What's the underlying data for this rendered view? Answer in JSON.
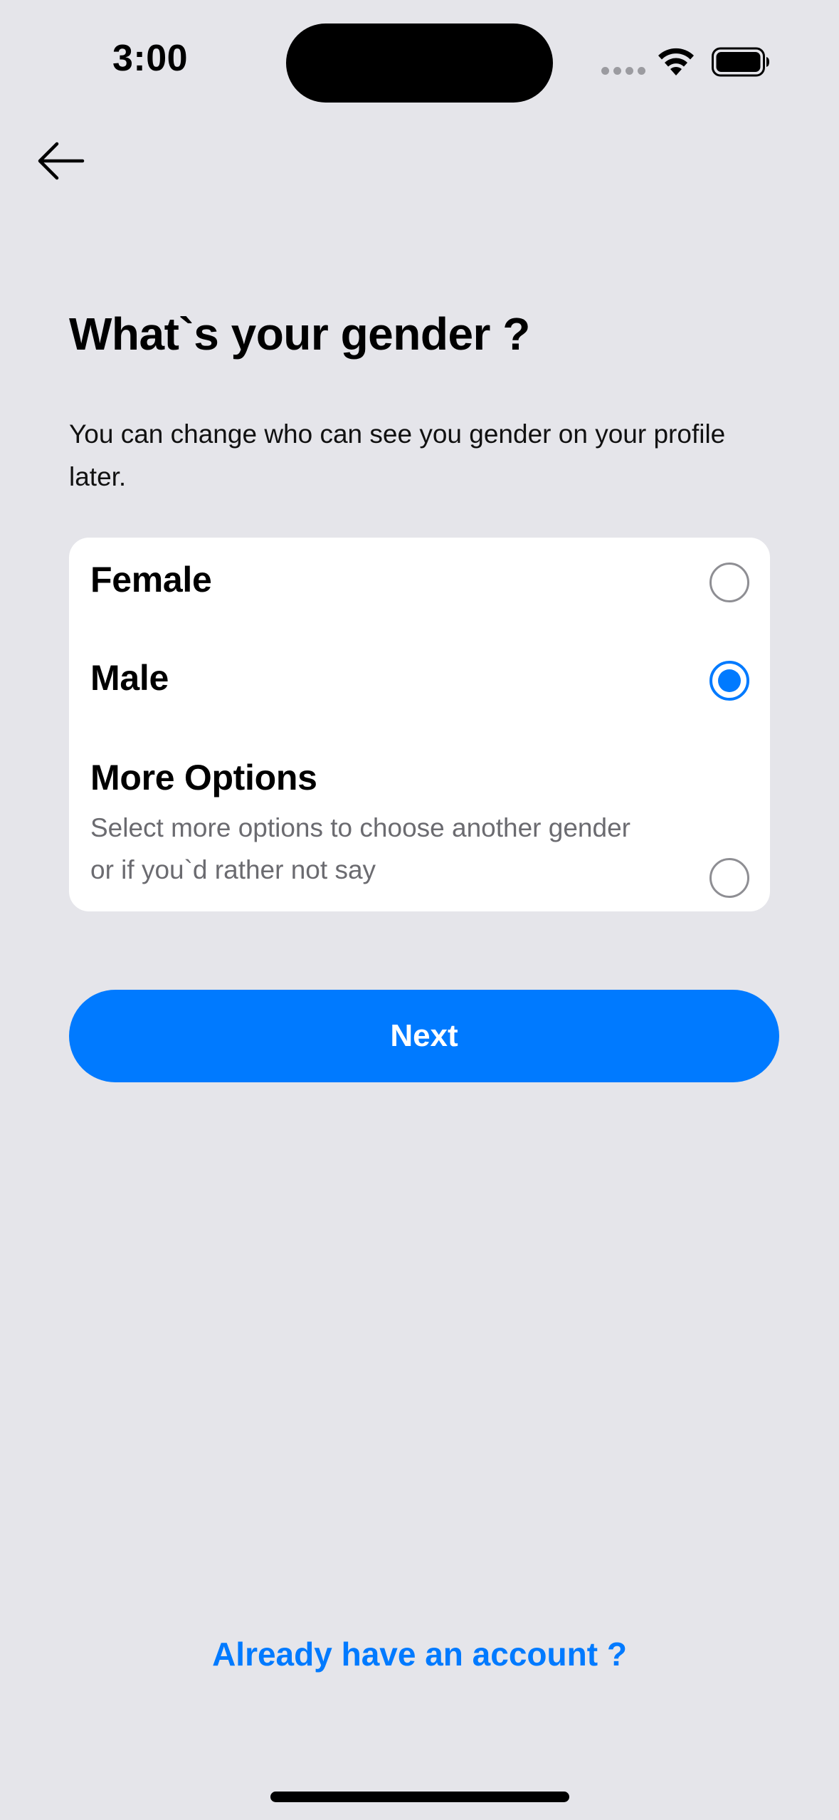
{
  "status_bar": {
    "time": "3:00"
  },
  "nav": {
    "back_icon": "arrow-left-icon"
  },
  "header": {
    "title": "What`s your gender ?",
    "subtitle": "You can change who can see you gender on your profile later."
  },
  "options": [
    {
      "label": "Female",
      "description": "",
      "selected": false
    },
    {
      "label": "Male",
      "description": "",
      "selected": true
    },
    {
      "label": "More Options",
      "description": "Select more options to choose another gender or if you`d rather not say",
      "selected": false
    }
  ],
  "actions": {
    "next_label": "Next",
    "login_link": "Already have an account ?"
  },
  "colors": {
    "accent": "#007aff",
    "background": "#e5e5ea",
    "card": "#ffffff"
  }
}
